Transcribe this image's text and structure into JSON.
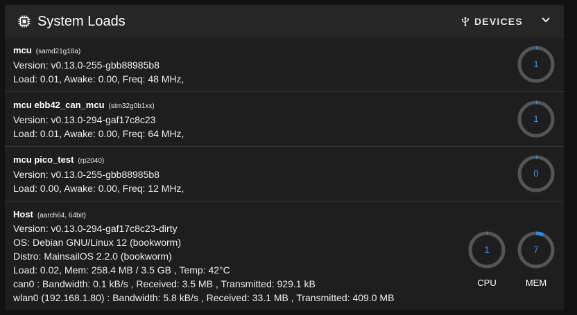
{
  "header": {
    "title": "System Loads",
    "devices_label": "DEVICES"
  },
  "colors": {
    "gauge_track": "#555555",
    "gauge_fill": "#2d8cf0",
    "gauge_text": "#3399ff"
  },
  "rows": [
    {
      "name": "mcu",
      "chip": "(samd21g18a)",
      "lines": [
        "Version: v0.13.0-255-gbb88985b8",
        "Load: 0.01, Awake: 0.00, Freq: 48 MHz,"
      ],
      "gauge_value": "1",
      "gauge_percent": 1
    },
    {
      "name": "mcu ebb42_can_mcu",
      "chip": "(stm32g0b1xx)",
      "lines": [
        "Version: v0.13.0-294-gaf17c8c23",
        "Load: 0.01, Awake: 0.00, Freq: 64 MHz,"
      ],
      "gauge_value": "1",
      "gauge_percent": 1
    },
    {
      "name": "mcu pico_test",
      "chip": "(rp2040)",
      "lines": [
        "Version: v0.13.0-255-gbb88985b8",
        "Load: 0.00, Awake: 0.00, Freq: 12 MHz,"
      ],
      "gauge_value": "0",
      "gauge_percent": 0
    },
    {
      "name": "Host",
      "chip": "(aarch64, 64bit)",
      "lines": [
        "Version: v0.13.0-294-gaf17c8c23-dirty",
        "OS: Debian GNU/Linux 12 (bookworm)",
        "Distro: MainsailOS 2.2.0 (bookworm)",
        "Load: 0.02, Mem: 258.4 MB / 3.5 GB , Temp: 42°C",
        "can0 : Bandwidth: 0.1 kB/s , Received: 3.5 MB , Transmitted: 929.1 kB",
        "wlan0 (192.168.1.80) : Bandwidth: 5.8 kB/s , Received: 33.1 MB , Transmitted: 409.0 MB"
      ],
      "cpu_value": "1",
      "cpu_percent": 1,
      "cpu_label": "CPU",
      "mem_value": "7",
      "mem_percent": 7,
      "mem_label": "MEM"
    }
  ]
}
